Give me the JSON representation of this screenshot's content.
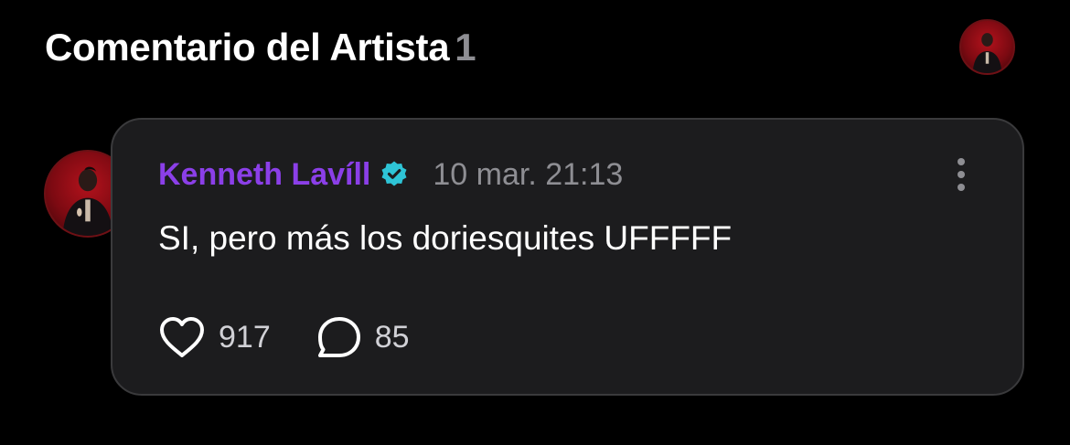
{
  "header": {
    "title": "Comentario del Artista",
    "count": "1",
    "avatar_icon": "artist-avatar"
  },
  "comment": {
    "author": "Kenneth Lavíll",
    "verified_icon": "verified-badge-icon",
    "verified_color": "#2ec4d6",
    "author_color": "#8b3fe8",
    "timestamp": "10 mar. 21:13",
    "text": "SI, pero más los doriesquites UFFFFF",
    "likes": "917",
    "replies": "85",
    "like_icon": "heart-icon",
    "reply_icon": "speech-bubble-icon",
    "more_icon": "more-vertical-icon"
  },
  "colors": {
    "background": "#000000",
    "card": "#1c1c1e",
    "card_border": "#3a3a3c",
    "muted": "#8e8e93"
  }
}
